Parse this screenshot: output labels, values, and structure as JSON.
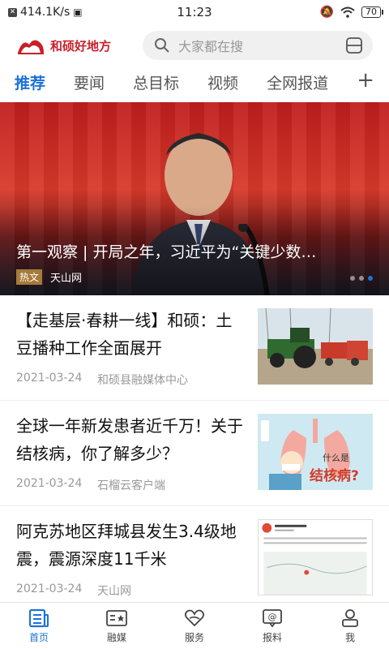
{
  "status_bar": {
    "speed": "414.1K/s",
    "time": "11:23",
    "battery": "70"
  },
  "header": {
    "logo_text": "和硕好地方",
    "search_placeholder": "大家都在搜"
  },
  "tabs": [
    {
      "label": "推荐",
      "active": true
    },
    {
      "label": "要闻"
    },
    {
      "label": "总目标"
    },
    {
      "label": "视频"
    },
    {
      "label": "全网报道"
    }
  ],
  "banner": {
    "title": "第一观察 | 开局之年，习近平为“关键少数…",
    "badge": "热文",
    "source": "天山网"
  },
  "news": [
    {
      "headline": "【走基层·春耕一线】和硕：土豆播种工作全面展开",
      "date": "2021-03-24",
      "source": "和硕县融媒体中心",
      "thumb_icon": "tractor-photo"
    },
    {
      "headline": "全球一年新发患者近千万！关于结核病，你了解多少？",
      "date": "2021-03-24",
      "source": "石榴云客户端",
      "thumb_icon": "tuberculosis-illustration",
      "thumb_text": {
        "line1": "什么是",
        "line2": "结核病?"
      }
    },
    {
      "headline": "阿克苏地区拜城县发生3.4级地震，震源深度11千米",
      "date": "2021-03-24",
      "source": "天山网",
      "thumb_icon": "earthquake-map"
    }
  ],
  "bottom_nav": [
    {
      "label": "首页",
      "icon": "newspaper-icon",
      "active": true
    },
    {
      "label": "融媒",
      "icon": "media-card-icon"
    },
    {
      "label": "服务",
      "icon": "heart-hands-icon"
    },
    {
      "label": "报料",
      "icon": "at-message-icon"
    },
    {
      "label": "我",
      "icon": "person-icon"
    }
  ],
  "colors": {
    "accent": "#1d72d8",
    "brand": "#c8202a"
  }
}
